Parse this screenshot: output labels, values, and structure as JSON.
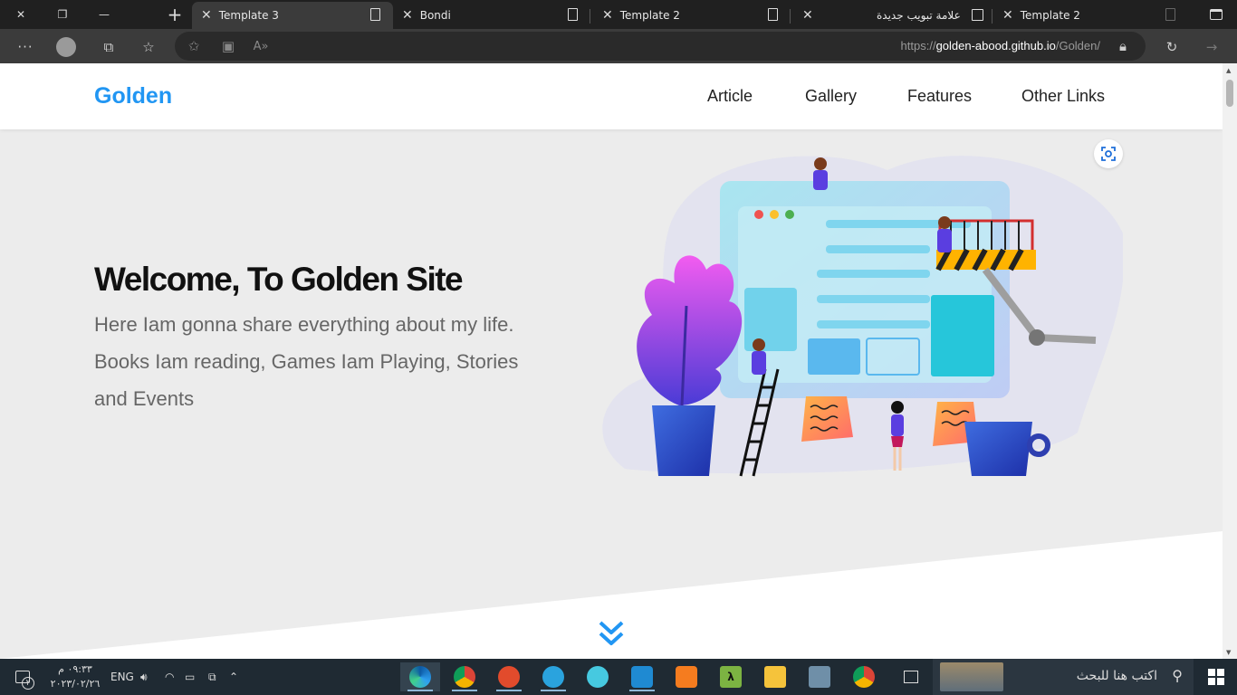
{
  "browser": {
    "tabs": [
      {
        "title": "Template 3",
        "active": true
      },
      {
        "title": "Bondi",
        "active": false
      },
      {
        "title": "Template 2",
        "active": false
      },
      {
        "title": "علامة تبويب جديدة",
        "active": false
      },
      {
        "title": "Template 2",
        "active": false
      }
    ],
    "url": {
      "prefix": "https://",
      "host": "golden-abood.github.io",
      "path": "/Golden/"
    }
  },
  "site": {
    "logo": "Golden",
    "nav": [
      "Article",
      "Gallery",
      "Features",
      "Other Links"
    ],
    "hero": {
      "title": "Welcome, To Golden Site",
      "text": "Here Iam gonna share everything about my life. Books Iam reading, Games Iam Playing, Stories and Events"
    }
  },
  "taskbar": {
    "search_placeholder": "اكتب هنا للبحث",
    "apps": [
      "edge-icon",
      "chrome-icon",
      "postman-icon",
      "telegram-icon",
      "electron-icon",
      "vscode-icon",
      "xampp-icon",
      "lambda-icon",
      "file-explorer-icon",
      "laptop-icon",
      "chrome-icon",
      "task-view-icon"
    ],
    "tray": {
      "language": "ENG",
      "time": "٠٩:٣٣ م",
      "date": "٢٠٢٣/٠٢/٢٦",
      "notif_count": "٢"
    }
  },
  "colors": {
    "brand": "#2196f3",
    "page_bg": "#ececec",
    "taskbar": "#1f2a33"
  }
}
